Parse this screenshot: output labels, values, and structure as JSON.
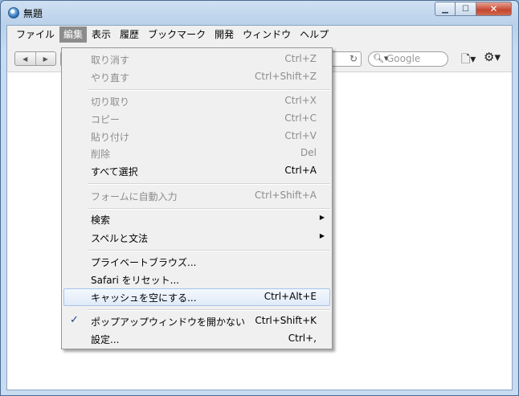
{
  "window": {
    "title": "無題"
  },
  "menubar": [
    "ファイル",
    "編集",
    "表示",
    "履歴",
    "ブックマーク",
    "開発",
    "ウィンドウ",
    "ヘルプ"
  ],
  "toolbar": {
    "search_placeholder": "Google",
    "reload": "↻"
  },
  "edit_menu": {
    "undo": {
      "label": "取り消す",
      "shortcut": "Ctrl+Z"
    },
    "redo": {
      "label": "やり直す",
      "shortcut": "Ctrl+Shift+Z"
    },
    "cut": {
      "label": "切り取り",
      "shortcut": "Ctrl+X"
    },
    "copy": {
      "label": "コピー",
      "shortcut": "Ctrl+C"
    },
    "paste": {
      "label": "貼り付け",
      "shortcut": "Ctrl+V"
    },
    "delete": {
      "label": "削除",
      "shortcut": "Del"
    },
    "select_all": {
      "label": "すべて選択",
      "shortcut": "Ctrl+A"
    },
    "autofill": {
      "label": "フォームに自動入力",
      "shortcut": "Ctrl+Shift+A"
    },
    "find": {
      "label": "検索"
    },
    "spelling": {
      "label": "スペルと文法"
    },
    "private": {
      "label": "プライベートブラウズ..."
    },
    "reset": {
      "label": "Safari をリセット..."
    },
    "empty_cache": {
      "label": "キャッシュを空にする...",
      "shortcut": "Ctrl+Alt+E"
    },
    "block_popups": {
      "label": "ポップアップウィンドウを開かない",
      "shortcut": "Ctrl+Shift+K",
      "checked": true
    },
    "settings": {
      "label": "設定...",
      "shortcut": "Ctrl+,"
    }
  }
}
